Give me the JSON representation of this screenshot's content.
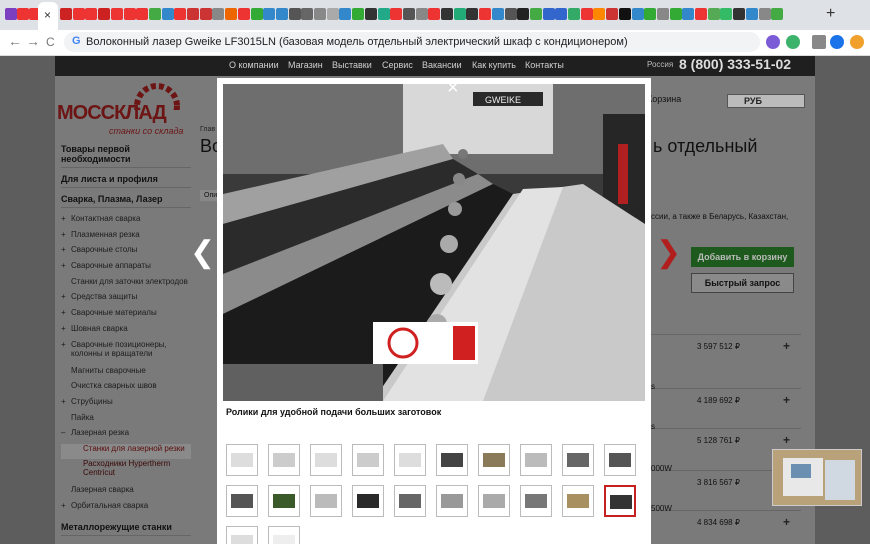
{
  "browser": {
    "url": "Волоконный лазер Gweike LF3015LN (базовая модель отдельный электрический шкаф с кондиционером)",
    "close_tab": "×",
    "new_tab": "+",
    "back": "←",
    "forward": "→",
    "reload": "C",
    "google_g": "G"
  },
  "topnav": {
    "items": [
      "О компании",
      "Магазин",
      "Выставки",
      "Сервис",
      "Вакансии",
      "Как купить",
      "Контакты"
    ],
    "region": "Россия",
    "phone": "8 (800) 333-51-02"
  },
  "logo": {
    "text": "МОССКЛАД",
    "sub": "станки со склада"
  },
  "header": {
    "cart": "Корзина",
    "currency": "РУБ"
  },
  "sidebar": {
    "h1": "Товары первой необходимости",
    "h2": "Для листа и профиля",
    "h3": "Сварка, Плазма, Лазер",
    "items": [
      "Контактная сварка",
      "Плазменная резка",
      "Сварочные столы",
      "Сварочные аппараты",
      "Станки для заточки электродов",
      "Средства защиты",
      "Сварочные материалы",
      "Шовная сварка",
      "Сварочные позиционеры, колонны и вращатели",
      "Магниты сварочные",
      "Очистка сварных швов",
      "Струбцины",
      "Пайка",
      "Лазерная резка"
    ],
    "sub_items": [
      "Станки для лазерной резки",
      "Расходники Hypertherm Centricut"
    ],
    "items2": [
      "Лазерная сварка",
      "Орбитальная сварка"
    ],
    "h4": "Металлорежущие станки"
  },
  "main": {
    "title_left": "Во",
    "title_right": "ь отдельный",
    "breadcrumb": "Глав",
    "tab": "Опи",
    "info_text": "ссии, а также в Беларусь, Казахстан,",
    "add_to_cart": "Добавить в корзину",
    "quick_request": "Быстрый запрос",
    "prices": [
      "3 597 512 ₽",
      "4 189 692 ₽",
      "5 128 761 ₽",
      "3 816 567 ₽",
      "4 834 698 ₽"
    ],
    "partial_labels": [
      "s",
      "s",
      "000W",
      "500W"
    ]
  },
  "lightbox": {
    "close": "×",
    "prev": "❮",
    "next": "❯",
    "caption": "Ролики для удобной подачи больших заготовок",
    "photo_brand": "GWEIKE",
    "thumbs_count": 22,
    "selected_thumb": 19
  },
  "colors": {
    "accent": "#c42020",
    "nav": "#1f1f1f",
    "green": "#2e8b2e"
  }
}
